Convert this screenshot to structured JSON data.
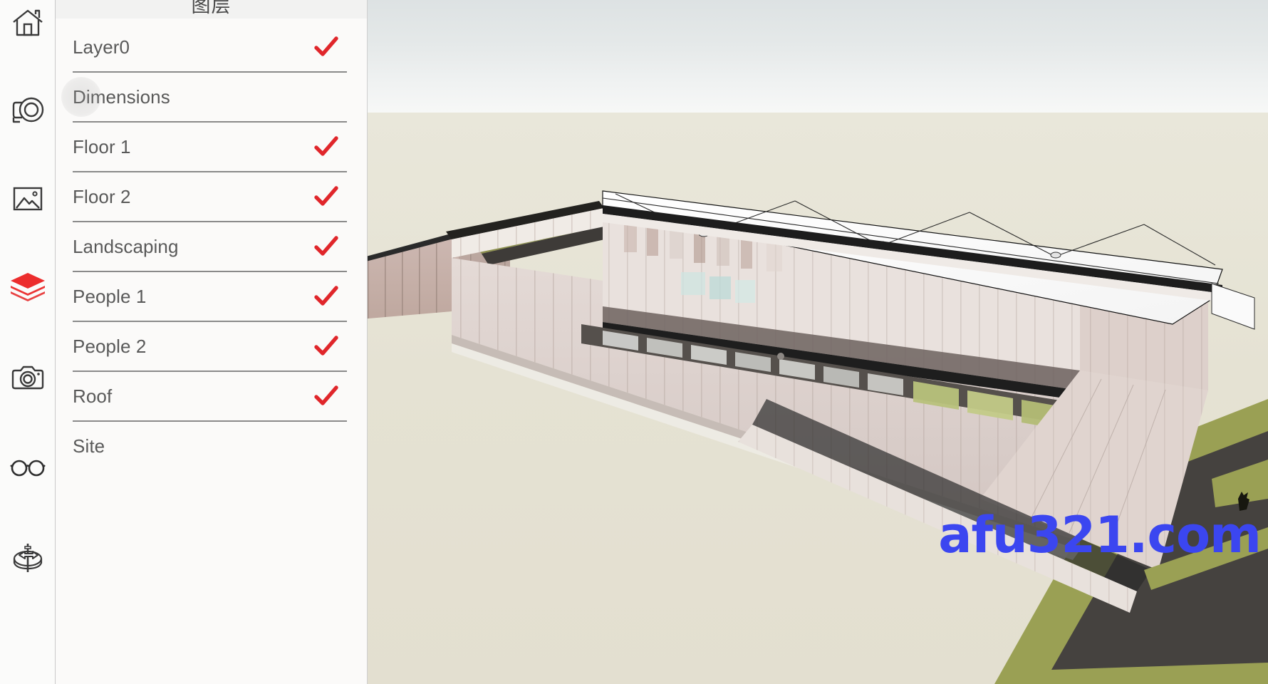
{
  "icon_rail": {
    "items": [
      {
        "name": "home-icon",
        "label": "Home"
      },
      {
        "name": "tape-measure-icon",
        "label": "Measure"
      },
      {
        "name": "image-icon",
        "label": "Image"
      },
      {
        "name": "layers-icon",
        "label": "Layers"
      },
      {
        "name": "camera-icon",
        "label": "Camera"
      },
      {
        "name": "glasses-icon",
        "label": "Glasses"
      },
      {
        "name": "orbit-icon",
        "label": "Orbit"
      }
    ],
    "active_index": 3,
    "active_color": "#e8302a"
  },
  "layers_panel": {
    "title": "图层",
    "check_color": "#e0262b",
    "layers": [
      {
        "name": "Layer0",
        "visible": true
      },
      {
        "name": "Dimensions",
        "visible": false
      },
      {
        "name": "Floor 1",
        "visible": true
      },
      {
        "name": "Floor 2",
        "visible": true
      },
      {
        "name": "Landscaping",
        "visible": true
      },
      {
        "name": "People 1",
        "visible": true
      },
      {
        "name": "People 2",
        "visible": true
      },
      {
        "name": "Roof",
        "visible": true
      },
      {
        "name": "Site",
        "visible": false
      }
    ],
    "ripple_on_index": 1
  },
  "viewport": {
    "sky_color_top": "#dde2e3",
    "sky_color_bottom": "#f7f8f7",
    "ground_color": "#e5e2d3",
    "building_wall_color": "#ddd2ce",
    "roof_color": "#fbfbfb",
    "lawn_color": "#9aa054",
    "pavement_color": "#45423f",
    "watermark": "afu321.com",
    "watermark_color": "#3b46f0"
  }
}
